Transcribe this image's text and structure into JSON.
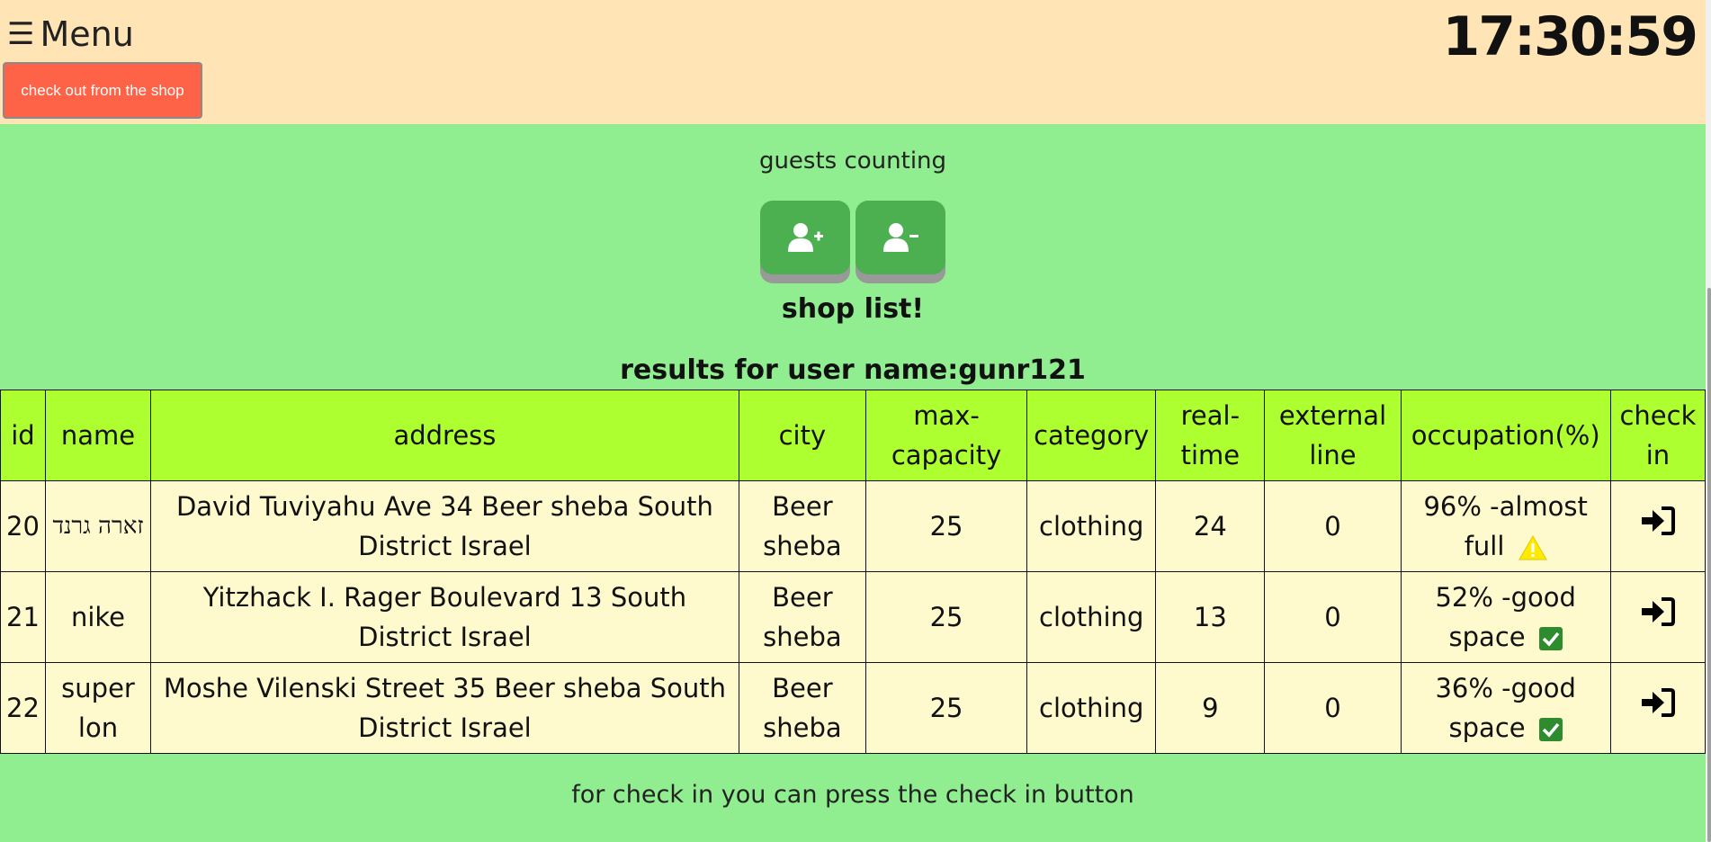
{
  "header": {
    "menu_icon": "☰",
    "menu_label": "Menu",
    "checkout_label": "check out from the shop",
    "clock": "17:30:59"
  },
  "guests": {
    "title": "guests counting",
    "add_icon": "user-plus-icon",
    "remove_icon": "user-minus-icon"
  },
  "shop_title": "shop list!",
  "results_title": "results for user name:gunr121",
  "table": {
    "headers": [
      "id",
      "name",
      "address",
      "city",
      "max-capacity",
      "category",
      "real-time",
      "external line",
      "occupation(%)",
      "check in"
    ],
    "rows": [
      {
        "id": "20",
        "name": "זארה גרנד",
        "address": "David Tuviyahu Ave 34 Beer sheba South District Israel",
        "city": "Beer sheba",
        "max_capacity": "25",
        "category": "clothing",
        "real_time": "24",
        "external_line": "0",
        "occupation": "96% -almost full",
        "status_icon": "warning-icon"
      },
      {
        "id": "21",
        "name": "nike",
        "address": "Yitzhack I. Rager Boulevard 13 South District Israel",
        "city": "Beer sheba",
        "max_capacity": "25",
        "category": "clothing",
        "real_time": "13",
        "external_line": "0",
        "occupation": "52% -good space",
        "status_icon": "checkmark-icon"
      },
      {
        "id": "22",
        "name": "super lon",
        "address": "Moshe Vilenski Street 35 Beer sheba South District Israel",
        "city": "Beer sheba",
        "max_capacity": "25",
        "category": "clothing",
        "real_time": "9",
        "external_line": "0",
        "occupation": "36% -good space",
        "status_icon": "checkmark-icon"
      }
    ]
  },
  "footer_note": "for check in you can press the check in button",
  "colors": {
    "header_bg": "#ffe4b5",
    "page_bg": "#90ee90",
    "checkout_btn": "#ff6347",
    "guest_btn": "#4caf50",
    "table_header_bg": "#adff2f",
    "table_row_bg": "#fffacd"
  }
}
